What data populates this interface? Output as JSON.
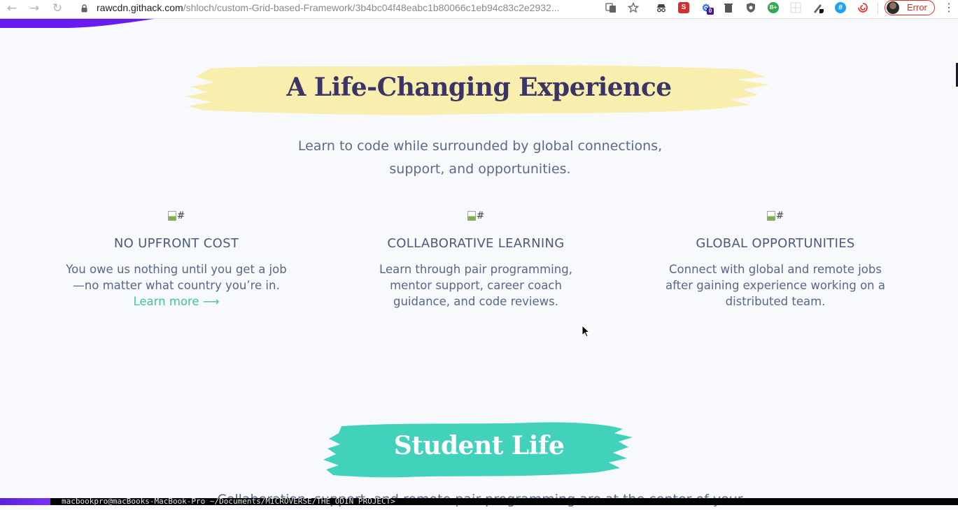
{
  "browser": {
    "url_host": "rawcdn.githack.com",
    "url_path": "/shloch/custom-Grid-based-Framework/3b4bc04f48eabc1b80066c1eb94c83c2e2932...",
    "profile_label": "Error",
    "extensions": [
      "translate-icon",
      "star-icon",
      "incognito-icon",
      "s-extension-icon",
      "badge-extension-icon",
      "trash-icon",
      "shield-icon",
      "b-plus-icon",
      "grid-icon",
      "pen-icon",
      "hash-icon",
      "loop-icon"
    ],
    "badge_count": "0",
    "b_plus_label": "B+",
    "s_label": "S",
    "hash_label": "#"
  },
  "section_experience": {
    "title": "A Life-Changing Experience",
    "lead_line1": "Learn to code while surrounded by global connections,",
    "lead_line2": "support, and opportunities.",
    "features": [
      {
        "img_alt": "#",
        "title": "NO UPFRONT COST",
        "text": "You owe us nothing until you get a job—no matter what country you’re in.",
        "link": "Learn more ⟶"
      },
      {
        "img_alt": "#",
        "title": "COLLABORATIVE LEARNING",
        "text": "Learn through pair programming, mentor support, career coach guidance, and code reviews."
      },
      {
        "img_alt": "#",
        "title": "GLOBAL OPPORTUNITIES",
        "text": "Connect with global and remote jobs after gaining experience working on a distributed team."
      }
    ],
    "brush_color": "#f8efae"
  },
  "section_student": {
    "title": "Student Life",
    "lead": "Collaboration, support, and remote pair programming are at the center of your",
    "brush_color": "#42d1bb"
  },
  "terminal": {
    "prompt": "macbookpro@macBooks-MacBook-Pro ~/Documents/MICROVERSE/THE_ODIN_PROJECT>"
  },
  "colors": {
    "heading": "#3b3466",
    "text": "#56678a",
    "link": "#3fc4a8",
    "accent": "#6a1bf0"
  }
}
